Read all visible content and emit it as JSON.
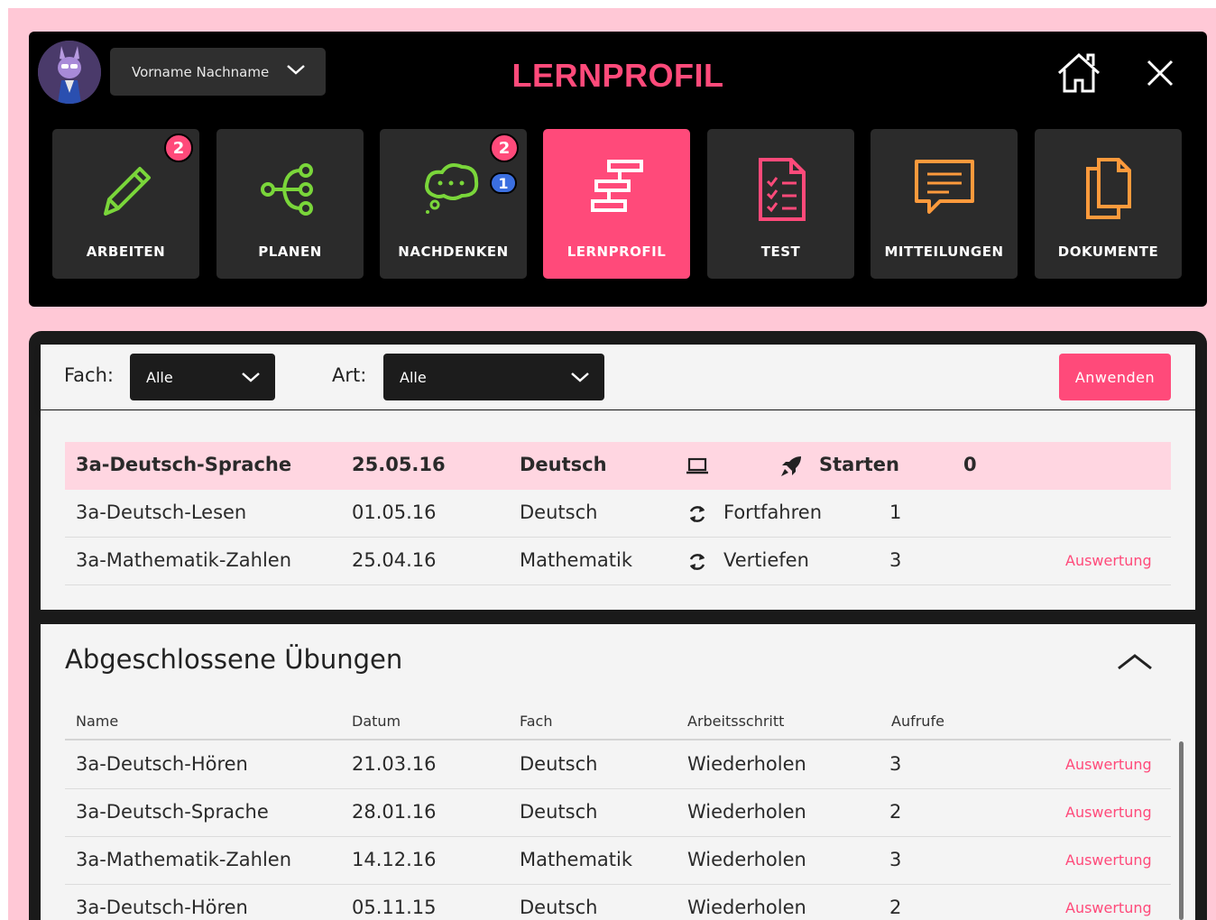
{
  "header": {
    "user_name": "Vorname Nachname",
    "title": "LERNPROFIL",
    "colors": {
      "accent": "#ff4a7a",
      "green": "#7ad63a",
      "orange": "#ff9a3c"
    }
  },
  "nav": [
    {
      "label": "ARBEITEN",
      "icon": "pencil-icon",
      "badge": "2"
    },
    {
      "label": "PLANEN",
      "icon": "flow-icon"
    },
    {
      "label": "NACHDENKEN",
      "icon": "thought-bubble-icon",
      "badge": "2",
      "badge2": "1"
    },
    {
      "label": "LERNPROFIL",
      "icon": "signpost-icon",
      "active": true
    },
    {
      "label": "TEST",
      "icon": "checklist-icon"
    },
    {
      "label": "MITTEILUNGEN",
      "icon": "message-icon"
    },
    {
      "label": "DOKUMENTE",
      "icon": "documents-icon"
    }
  ],
  "filters": {
    "fach_label": "Fach:",
    "fach_value": "Alle",
    "art_label": "Art:",
    "art_value": "Alle",
    "apply_label": "Anwenden"
  },
  "current": [
    {
      "name": "3a-Deutsch-Sprache",
      "date": "25.05.16",
      "subject": "Deutsch",
      "type_icon": "laptop-icon",
      "step_icon": "rocket-icon",
      "step": "Starten",
      "count": "0",
      "link": ""
    },
    {
      "name": "3a-Deutsch-Lesen",
      "date": "01.05.16",
      "subject": "Deutsch",
      "step_icon": "refresh-icon",
      "step": "Fortfahren",
      "count": "1",
      "link": ""
    },
    {
      "name": "3a-Mathematik-Zahlen",
      "date": "25.04.16",
      "subject": "Mathematik",
      "step_icon": "refresh-icon",
      "step": "Vertiefen",
      "count": "3",
      "link": "Auswertung"
    }
  ],
  "completed": {
    "title": "Abgeschlossene Übungen",
    "columns": [
      "Name",
      "Datum",
      "Fach",
      "Arbeitsschritt",
      "Aufrufe"
    ],
    "rows": [
      {
        "name": "3a-Deutsch-Hören",
        "date": "21.03.16",
        "subject": "Deutsch",
        "step": "Wiederholen",
        "count": "3",
        "link": "Auswertung"
      },
      {
        "name": "3a-Deutsch-Sprache",
        "date": "28.01.16",
        "subject": "Deutsch",
        "step": "Wiederholen",
        "count": "2",
        "link": "Auswertung"
      },
      {
        "name": "3a-Mathematik-Zahlen",
        "date": "14.12.16",
        "subject": "Mathematik",
        "step": "Wiederholen",
        "count": "3",
        "link": "Auswertung"
      },
      {
        "name": "3a-Deutsch-Hören",
        "date": "05.11.15",
        "subject": "Deutsch",
        "step": "Wiederholen",
        "count": "2",
        "link": "Auswertung"
      }
    ]
  }
}
